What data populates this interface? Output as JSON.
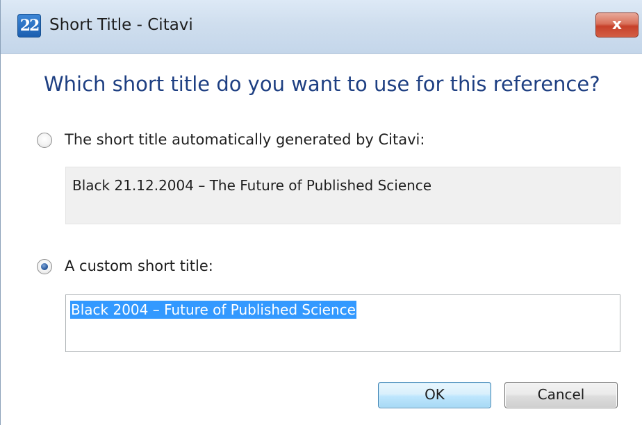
{
  "window": {
    "title": "Short Title - Citavi",
    "app_icon_glyph": "22",
    "close_glyph": "x",
    "icon": "citavi-app-icon"
  },
  "dialog": {
    "question": "Which short title do you want to use for this reference?",
    "options": [
      {
        "label": "The short title automatically generated by Citavi:",
        "selected": false,
        "value": "Black 21.12.2004 – The Future of Published Science"
      },
      {
        "label": "A custom short title:",
        "selected": true,
        "value": "Black 2004 – Future of Published Science"
      }
    ]
  },
  "buttons": {
    "ok_label": "OK",
    "cancel_label": "Cancel"
  },
  "colors": {
    "question_text": "#1e3f82",
    "selection_highlight": "#3399ff",
    "readonly_box": "#f0f0f0"
  }
}
